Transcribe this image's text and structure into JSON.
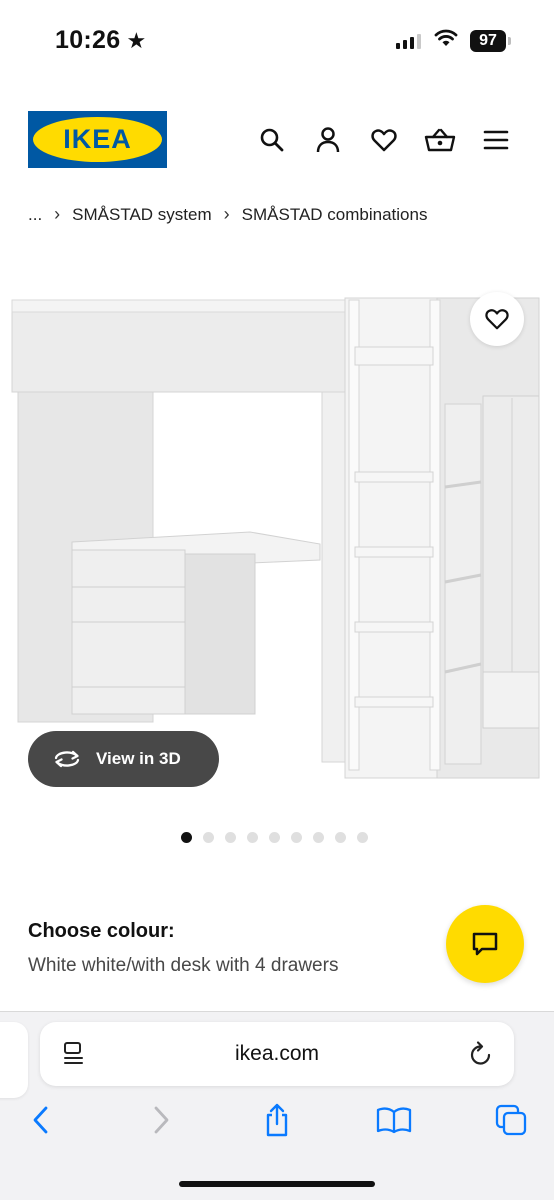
{
  "status_bar": {
    "time": "10:26",
    "star_glyph": "★",
    "battery": "97",
    "icons": [
      "signal-icon",
      "wifi-icon",
      "battery-icon"
    ]
  },
  "header": {
    "logo_text": "IKEA",
    "brand_colors": {
      "blue": "#0058a3",
      "yellow": "#ffdb00"
    },
    "icons": [
      "search-icon",
      "user-icon",
      "heart-icon",
      "basket-icon",
      "menu-icon"
    ]
  },
  "breadcrumb": {
    "items": [
      "...",
      "SMÅSTAD system",
      "SMÅSTAD combinations"
    ],
    "separator": "›"
  },
  "product": {
    "image_icon": "loft-bed-desk-wardrobe-image",
    "favourite_icon": "heart-icon",
    "view_3d_label": "View in 3D",
    "view_3d_icon": "rotate-3d-icon",
    "view_3d_color": "#484848",
    "carousel": {
      "total": 9,
      "active": 1
    }
  },
  "colour": {
    "title": "Choose colour:",
    "value": "White white/with desk with 4 drawers"
  },
  "chat": {
    "icon": "chat-icon",
    "color": "#ffdb00"
  },
  "browser": {
    "url": "ikea.com",
    "icons": [
      "reader-icon",
      "reload-icon",
      "back-icon",
      "forward-icon",
      "share-icon",
      "bookmarks-icon",
      "tabs-icon"
    ],
    "accent": "#0a7aff"
  }
}
